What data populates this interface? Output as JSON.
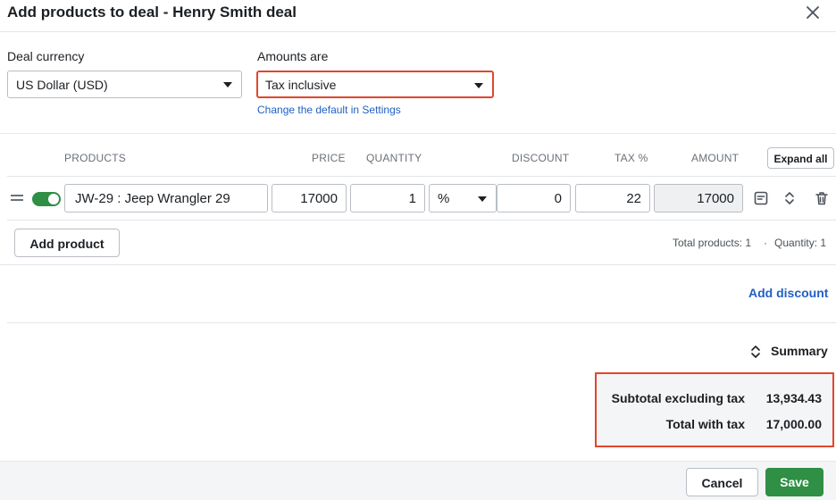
{
  "dialog": {
    "title": "Add products to deal - Henry Smith deal"
  },
  "settings": {
    "currency_label": "Deal currency",
    "currency_value": "US Dollar (USD)",
    "amounts_label": "Amounts are",
    "amounts_value": "Tax inclusive",
    "settings_link": "Change the default in Settings"
  },
  "table": {
    "headers": {
      "products": "PRODUCTS",
      "price": "PRICE",
      "quantity": "QUANTITY",
      "discount": "DISCOUNT",
      "tax": "TAX %",
      "amount": "AMOUNT"
    },
    "expand_all": "Expand all",
    "rows": [
      {
        "product": "JW-29 : Jeep Wrangler 29",
        "price": "17000",
        "quantity": "1",
        "discount_type": "%",
        "discount": "0",
        "tax": "22",
        "amount": "17000",
        "enabled": true
      }
    ]
  },
  "actions": {
    "add_product": "Add product",
    "total_products": "Total products: 1",
    "dot": "·",
    "quantity_total": "Quantity: 1",
    "add_discount": "Add discount"
  },
  "summary": {
    "label": "Summary",
    "subtotal_label": "Subtotal excluding tax",
    "subtotal_value": "13,934.43",
    "total_label": "Total with tax",
    "total_value": "17,000.00"
  },
  "footer": {
    "cancel": "Cancel",
    "save": "Save"
  },
  "colors": {
    "accent_green": "#2f8f44",
    "link_blue": "#2160c4",
    "highlight_red": "#e2462c"
  }
}
